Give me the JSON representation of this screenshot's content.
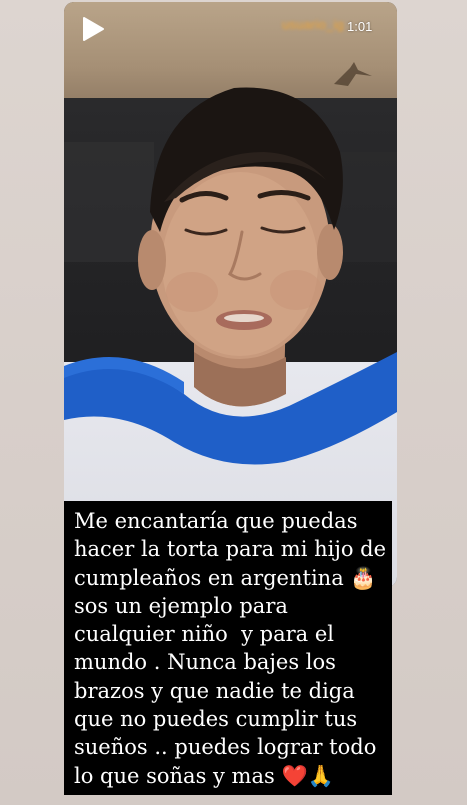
{
  "story": {
    "play_icon": "play-icon",
    "username": "usuario_ig",
    "duration": "1:01"
  },
  "caption": {
    "text": "Me encantaría que puedas\nhacer la torta para mi hijo de\ncumpleaños en argentina 🎂\nsos un ejemplo para\ncualquier niño  y para el\nmundo . Nunca bajes los\nbrazos y que nadie te diga\nque no puedes cumplir tus\nsueños .. puedes lograr todo\nlo que soñas y mas ❤️🙏"
  },
  "colors": {
    "caption_background": "#000000",
    "caption_text": "#ffffff",
    "username": "#e8a23a",
    "shirt_band": "#1f5fc8",
    "page_background": "#d9d1cc"
  }
}
